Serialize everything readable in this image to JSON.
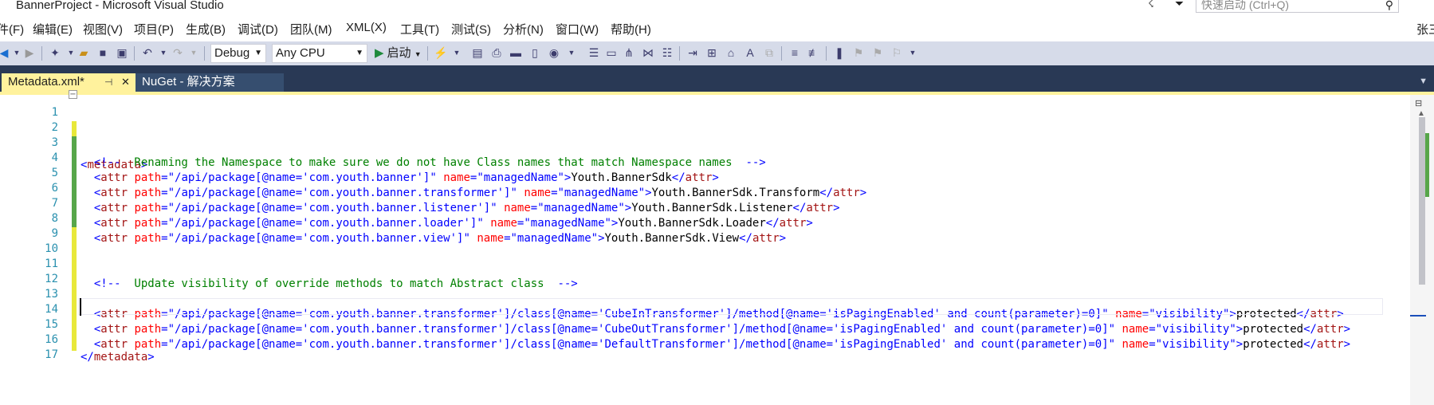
{
  "window": {
    "title": "BannerProject - Microsoft Visual Studio",
    "quick_launch_placeholder": "快速启动 (Ctrl+Q)"
  },
  "menu": [
    "件(F)",
    "编辑(E)",
    "视图(V)",
    "项目(P)",
    "生成(B)",
    "调试(D)",
    "团队(M)",
    "XML(X)",
    "工具(T)",
    "测试(S)",
    "分析(N)",
    "窗口(W)",
    "帮助(H)"
  ],
  "user": "张三",
  "toolbar": {
    "config": "Debug",
    "platform": "Any CPU",
    "start": "启动"
  },
  "tabs": [
    {
      "label": "Metadata.xml*",
      "active": true
    },
    {
      "label": "NuGet - 解决方案",
      "active": false
    }
  ],
  "editor": {
    "lines": [
      {
        "n": "1",
        "change": "yellow"
      },
      {
        "n": "2",
        "change": "green"
      },
      {
        "n": "3",
        "change": "green"
      },
      {
        "n": "4",
        "change": "green"
      },
      {
        "n": "5",
        "change": "green"
      },
      {
        "n": "6",
        "change": "green"
      },
      {
        "n": "7",
        "change": "green"
      },
      {
        "n": "8",
        "change": "yellow"
      },
      {
        "n": "9",
        "change": "yellow"
      },
      {
        "n": "10",
        "change": "yellow"
      },
      {
        "n": "11",
        "change": "yellow"
      },
      {
        "n": "12",
        "change": "yellow"
      },
      {
        "n": "13",
        "change": "yellow"
      },
      {
        "n": "14",
        "change": "yellow"
      },
      {
        "n": "15",
        "change": "yellow"
      },
      {
        "n": "16",
        "change": "none"
      },
      {
        "n": "17",
        "change": "none"
      }
    ],
    "root_tag": "metadata",
    "comment1": "  Renaming the Namespace to make sure we do not have Class names that match Namespace names  ",
    "comment2": "  Update visibility of override methods to match Abstract class  ",
    "attr_tag": "attr",
    "path_attr": "path",
    "name_attr": "name",
    "managed_name": "managedName",
    "visibility_name": "visibility",
    "path1": "/api/package[@name='com.youth.banner']",
    "path2": "/api/package[@name='com.youth.banner.transformer']",
    "path3": "/api/package[@name='com.youth.banner.listener']",
    "path4": "/api/package[@name='com.youth.banner.loader']",
    "path5": "/api/package[@name='com.youth.banner.view']",
    "value1": "Youth.BannerSdk",
    "value2": "Youth.BannerSdk.Transform",
    "value3": "Youth.BannerSdk.Listener",
    "value4": "Youth.BannerSdk.Loader",
    "value5": "Youth.BannerSdk.View",
    "path12": "/api/package[@name='com.youth.banner.transformer']/class[@name='CubeInTransformer']/method[@name='isPagingEnabled' and count(parameter)=0]",
    "path13": "/api/package[@name='com.youth.banner.transformer']/class[@name='CubeOutTransformer']/method[@name='isPagingEnabled' and count(parameter)=0]",
    "path14": "/api/package[@name='com.youth.banner.transformer']/class[@name='DefaultTransformer']/method[@name='isPagingEnabled' and count(parameter)=0]",
    "protected": "protected"
  }
}
